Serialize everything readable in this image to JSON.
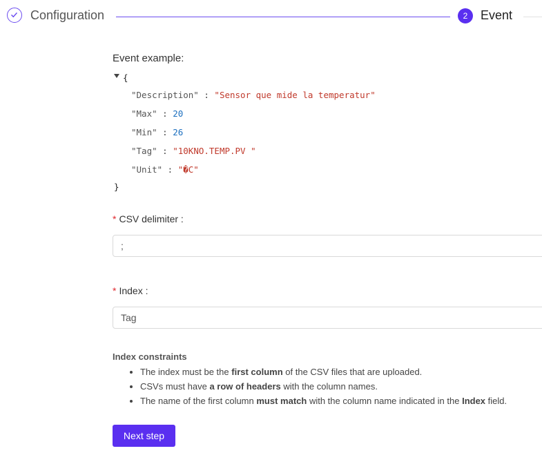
{
  "steps": {
    "step1": {
      "label": "Configuration",
      "icon": "check-icon"
    },
    "step2": {
      "number": "2",
      "label": "Event"
    }
  },
  "event_example": {
    "label": "Event example:",
    "open_brace": "{",
    "close_brace": "}",
    "rows": [
      {
        "key": "\"Description\"",
        "sep": " : ",
        "value": "\"Sensor que mide la temperatur\"",
        "type": "string"
      },
      {
        "key": "\"Max\"",
        "sep": " : ",
        "value": "20",
        "type": "number"
      },
      {
        "key": "\"Min\"",
        "sep": " : ",
        "value": "26",
        "type": "number"
      },
      {
        "key": "\"Tag\"",
        "sep": " : ",
        "value": "\"10KNO.TEMP.PV \"",
        "type": "string"
      },
      {
        "key": "\"Unit\"",
        "sep": " : ",
        "value": "\"�C\"",
        "type": "string"
      }
    ]
  },
  "csv_delimiter": {
    "required_mark": "*",
    "label": "CSV delimiter :",
    "value": ";"
  },
  "index": {
    "required_mark": "*",
    "label": "Index :",
    "value": "Tag"
  },
  "constraints": {
    "title": "Index constraints",
    "items": [
      [
        {
          "t": "The index must be the ",
          "b": false
        },
        {
          "t": "first column",
          "b": true
        },
        {
          "t": " of the CSV files that are uploaded.",
          "b": false
        }
      ],
      [
        {
          "t": "CSVs must have ",
          "b": false
        },
        {
          "t": "a row of headers",
          "b": true
        },
        {
          "t": " with the column names.",
          "b": false
        }
      ],
      [
        {
          "t": "The name of the first column ",
          "b": false
        },
        {
          "t": "must match",
          "b": true
        },
        {
          "t": " with the column name indicated in the ",
          "b": false
        },
        {
          "t": "Index",
          "b": true
        },
        {
          "t": " field.",
          "b": false
        }
      ]
    ]
  },
  "next_button": {
    "label": "Next step"
  },
  "colors": {
    "accent": "#5a2ff0",
    "required": "#e0282e",
    "number": "#1c6fbf",
    "string": "#c0392b"
  }
}
